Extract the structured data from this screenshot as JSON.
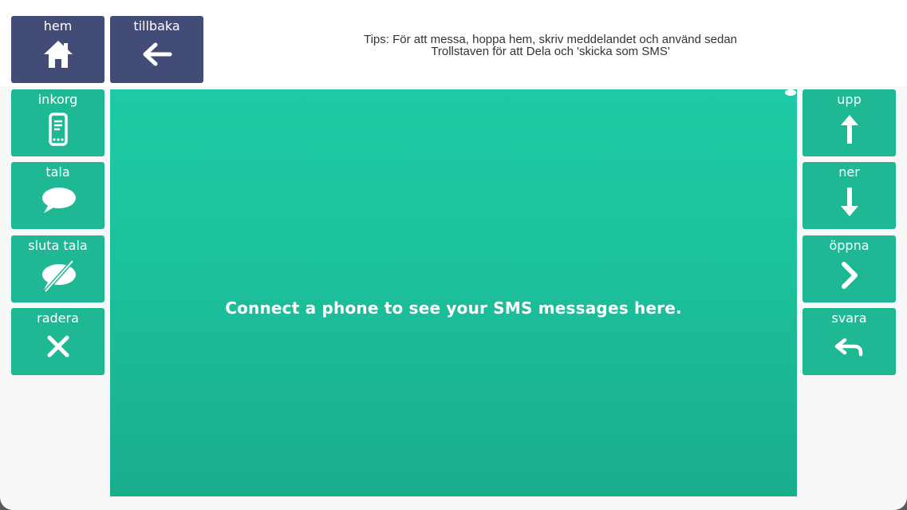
{
  "tips": {
    "line1": "Tips: För att messa, hoppa hem, skriv meddelandet och använd sedan",
    "line2": "Trollstaven för att Dela och 'skicka som SMS'"
  },
  "nav": {
    "home_label": "hem",
    "back_label": "tillbaka"
  },
  "left_column": {
    "inbox_label": "inkorg",
    "speak_label": "tala",
    "stop_speak_label": "sluta tala",
    "delete_label": "radera"
  },
  "right_column": {
    "up_label": "upp",
    "down_label": "ner",
    "open_label": "öppna",
    "reply_label": "svara"
  },
  "main": {
    "message": "Connect a phone to see your SMS messages here."
  },
  "colors": {
    "nav_cell": "#434c76",
    "action_cell": "#1eb894",
    "message_area": "#1ecba6",
    "background": "#f8f8f8"
  },
  "icons": {
    "home": "home-icon",
    "back": "arrow-left-icon",
    "inbox": "phone-icon",
    "speak": "speech-bubble-icon",
    "stop_speak": "speech-bubble-muted-icon",
    "delete": "close-icon",
    "up": "arrow-up-icon",
    "down": "arrow-down-icon",
    "open": "chevron-right-icon",
    "reply": "reply-icon"
  }
}
